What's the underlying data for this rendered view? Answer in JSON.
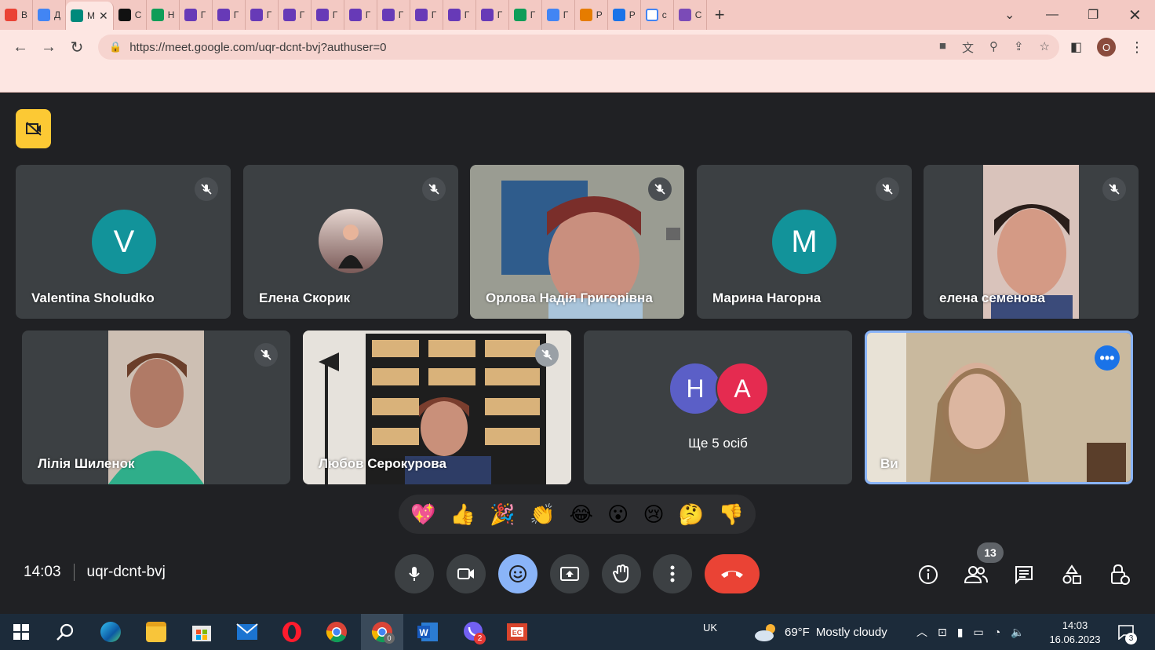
{
  "browser": {
    "tabs": [
      {
        "title": "В",
        "color": "#ea4335",
        "active": false,
        "icon": "gmail-icon"
      },
      {
        "title": "Д",
        "color": "#4285f4",
        "active": false,
        "icon": "calendar-icon"
      },
      {
        "title": "М",
        "color": "#00897b",
        "active": true,
        "icon": "meet-icon"
      },
      {
        "title": "С",
        "color": "#111111",
        "active": false,
        "icon": "diia-icon"
      },
      {
        "title": "Н",
        "color": "#0f9d58",
        "active": false,
        "icon": "drive-icon"
      },
      {
        "title": "Г",
        "color": "#673ab7",
        "active": false,
        "icon": "forms-icon"
      },
      {
        "title": "Г",
        "color": "#673ab7",
        "active": false,
        "icon": "forms-icon"
      },
      {
        "title": "Г",
        "color": "#673ab7",
        "active": false,
        "icon": "forms-icon"
      },
      {
        "title": "Г",
        "color": "#673ab7",
        "active": false,
        "icon": "forms-icon"
      },
      {
        "title": "Г",
        "color": "#673ab7",
        "active": false,
        "icon": "forms-icon"
      },
      {
        "title": "Г",
        "color": "#673ab7",
        "active": false,
        "icon": "forms-icon"
      },
      {
        "title": "Г",
        "color": "#673ab7",
        "active": false,
        "icon": "forms-icon"
      },
      {
        "title": "Г",
        "color": "#673ab7",
        "active": false,
        "icon": "forms-icon"
      },
      {
        "title": "Г",
        "color": "#673ab7",
        "active": false,
        "icon": "forms-icon"
      },
      {
        "title": "Г",
        "color": "#673ab7",
        "active": false,
        "icon": "forms-icon"
      },
      {
        "title": "Г",
        "color": "#0f9d58",
        "active": false,
        "icon": "drive-icon"
      },
      {
        "title": "Г",
        "color": "#4285f4",
        "active": false,
        "icon": "docs-icon"
      },
      {
        "title": "Р",
        "color": "#e67c00",
        "active": false,
        "icon": "slides-icon"
      },
      {
        "title": "Р",
        "color": "#1a73e8",
        "active": false,
        "icon": "classroom-icon"
      },
      {
        "title": "с",
        "color": "#ffffff",
        "active": false,
        "icon": "google-icon"
      },
      {
        "title": "С",
        "color": "#7b4bb7",
        "active": false,
        "icon": "extension-icon"
      }
    ],
    "url": "https://meet.google.com/uqr-dcnt-bvj?authuser=0",
    "profile_initial": "O"
  },
  "meet": {
    "tiles_row1": [
      {
        "name": "Valentina Sholudko",
        "type": "avatar",
        "initial": "V",
        "color": "#12939a"
      },
      {
        "name": "Елена Скорик",
        "type": "photo",
        "initial": "",
        "color": "#b58f8a"
      },
      {
        "name": "Орлова Надія Григорівна",
        "type": "video",
        "initial": "",
        "color": "#8a8d84"
      },
      {
        "name": "Марина Нагорна",
        "type": "avatar",
        "initial": "M",
        "color": "#12939a"
      },
      {
        "name": "елена семенова",
        "type": "video",
        "initial": "",
        "color": "#c9b4a8"
      }
    ],
    "tiles_row2": [
      {
        "name": "Лілія Шиленок",
        "type": "video",
        "color": "#6a8f7a"
      },
      {
        "name": "Любов Серокурова",
        "type": "video",
        "color": "#bba489"
      },
      {
        "name": "Ще 5 осіб",
        "type": "group",
        "initials": [
          "Н",
          "A"
        ],
        "colors": [
          "#5b5fc7",
          "#e52b50"
        ]
      },
      {
        "name": "Ви",
        "type": "self",
        "color": "#b9a98f"
      }
    ],
    "reactions": [
      "💖",
      "👍",
      "🎉",
      "👏",
      "😂",
      "😮",
      "😢",
      "🤔",
      "👎"
    ],
    "time": "14:03",
    "meeting_code": "uqr-dcnt-bvj",
    "participants_count": "13"
  },
  "taskbar": {
    "lang": "UK",
    "weather_temp": "69°F",
    "weather_text": "Mostly cloudy",
    "clock_time": "14:03",
    "clock_date": "16.06.2023",
    "notifications": "3",
    "viber_badge": "2",
    "chrome_badge": "0"
  }
}
